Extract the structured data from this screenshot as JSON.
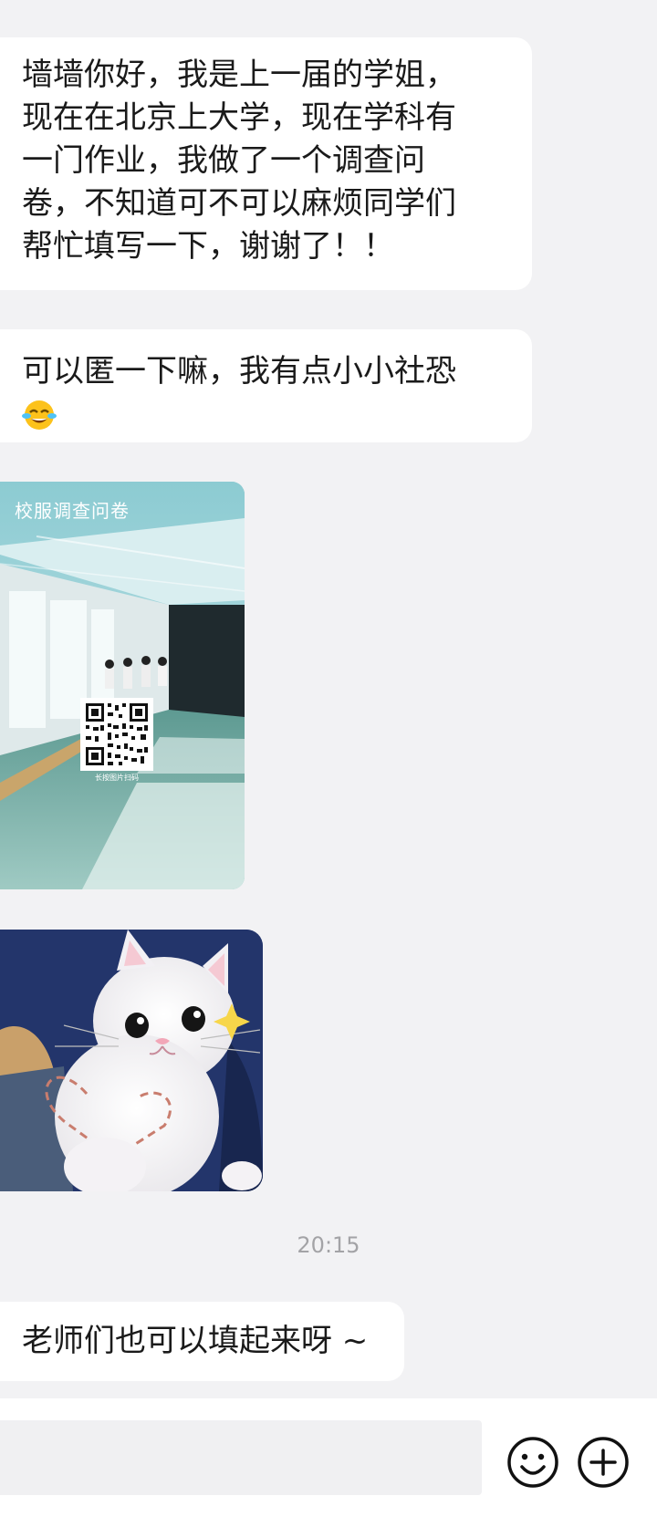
{
  "messages": [
    {
      "text": "墙墙你好，我是上一届的学姐，\n现在在北京上大学，现在学科有\n一门作业，我做了一个调查问\n卷，不知道可不可以麻烦同学们\n帮忙填写一下，谢谢了！！"
    },
    {
      "text": "可以匿一下嘛，我有点小小社恐",
      "emoji": "crying-laughing-emoji"
    },
    {
      "text": "老师们也可以填起来呀 ~"
    }
  ],
  "survey_card": {
    "title": "校服调查问卷",
    "qr_caption": "长按图片扫码"
  },
  "timestamp": "20:15",
  "input_bar": {
    "emoji_icon": "smiley-icon",
    "more_icon": "plus-circle-icon"
  },
  "colors": {
    "chat_bg": "#f2f2f4",
    "bubble_bg": "#ffffff",
    "timestamp": "#a3a3a6"
  }
}
